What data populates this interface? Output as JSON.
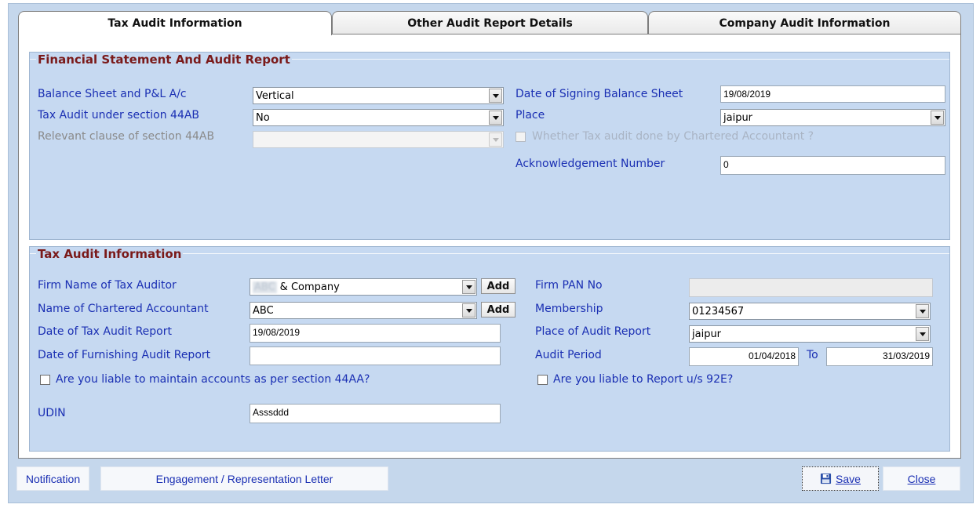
{
  "tabs": [
    {
      "label": "Tax Audit Information",
      "active": true
    },
    {
      "label": "Other Audit Report Details",
      "active": false
    },
    {
      "label": "Company Audit Information",
      "active": false
    }
  ],
  "financial": {
    "title": "Financial Statement And Audit Report",
    "balance_sheet_label": "Balance Sheet and P&L A/c",
    "balance_sheet_value": "Vertical",
    "tax_audit_44ab_label": "Tax Audit  under section 44AB",
    "tax_audit_44ab_value": "No",
    "relevant_clause_label": "Relevant clause of section 44AB",
    "relevant_clause_value": "",
    "date_signing_label": "Date of Signing Balance Sheet",
    "date_signing_value": "19/08/2019",
    "place_label": "Place",
    "place_value": "jaipur",
    "ca_done_label": "Whether Tax audit done by Chartered Accountant ?",
    "ack_label": "Acknowledgement Number",
    "ack_value": "0"
  },
  "tax_audit": {
    "title": "Tax Audit Information",
    "firm_name_label": "Firm Name of Tax Auditor",
    "firm_name_blurred": "ABC",
    "firm_name_value": "& Company",
    "ca_name_label": "Name of Chartered Accountant",
    "ca_name_value": "ABC",
    "add_label": "Add",
    "date_report_label": "Date of Tax Audit Report",
    "date_report_value": "19/08/2019",
    "date_furnishing_label": "Date of Furnishing Audit Report",
    "date_furnishing_value": "",
    "liable_44aa_label": "Are you liable to maintain accounts as per section 44AA?",
    "udin_label": "UDIN",
    "udin_value": "Asssddd",
    "firm_pan_label": "Firm PAN No",
    "firm_pan_value": "",
    "membership_label": "Membership",
    "membership_value": "01234567",
    "place_report_label": "Place of Audit Report",
    "place_report_value": "jaipur",
    "audit_period_label": "Audit Period",
    "audit_period_from": "01/04/2018",
    "to_label": "To",
    "audit_period_to": "31/03/2019",
    "liable_92e_label": "Are you liable to Report u/s 92E?"
  },
  "footer": {
    "notification": "Notification",
    "engagement": "Engagement / Representation Letter",
    "save": "Save",
    "close": "Close"
  },
  "icons": {
    "save": "floppy-disk-icon",
    "dropdown": "chevron-down-icon"
  }
}
